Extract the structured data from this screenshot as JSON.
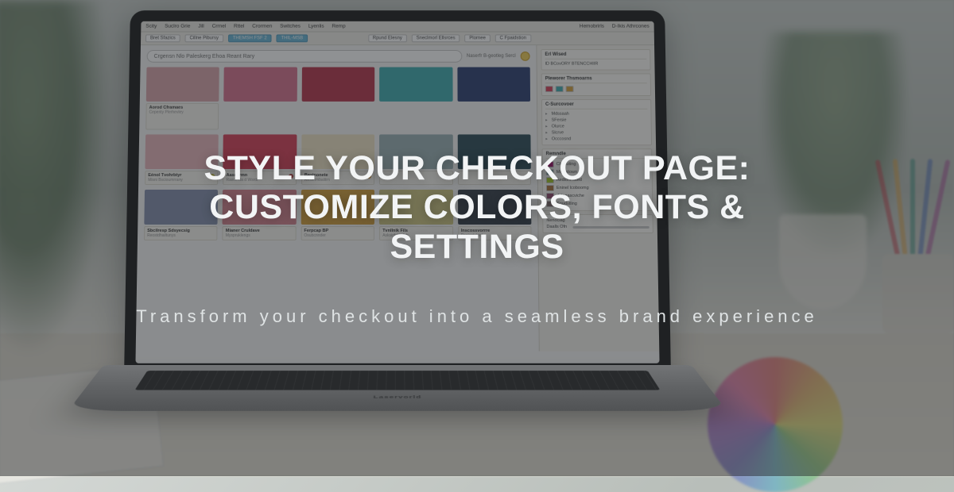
{
  "hero": {
    "title": "STYLE YOUR CHECKOUT PAGE: CUSTOMIZE COLORS, FONTS & SETTINGS",
    "subtitle": "Transform your checkout into a seamless brand experience"
  },
  "laptop": {
    "brand": "Laservorld"
  },
  "app": {
    "menubar": [
      "Scity",
      "Suclro Grie",
      "Jill",
      "Crrnel",
      "Rttel",
      "Crormen",
      "Switches",
      "Lyenlis",
      "Remp"
    ],
    "menubar_right": [
      "Hemobrirls",
      "D-Ikis Athrcones"
    ],
    "toolbar1": {
      "items": [
        "Bret Sfazics",
        "Cillne Pibursy"
      ],
      "accent": "THEMSH FSF 2",
      "accent2": "THIL-MSB"
    },
    "toolbar2": {
      "items": [
        "Rpund Elesny",
        "Sneclmorl Ellsrces",
        "Plornee",
        "C Fpaidstion"
      ]
    },
    "search": {
      "placeholder": "Crgensn Nlo Paleskerg  Ehoa Reant Rary",
      "side_label": "Naserfr B-geotleg Sercl"
    },
    "swatches": [
      {
        "color": "#dba9ae",
        "name": "Aorod Cframaes",
        "sub": "Ceperity Plerhevley"
      },
      {
        "color": "#d97a95",
        "name": "",
        "sub": ""
      },
      {
        "color": "#ba4055",
        "name": "",
        "sub": ""
      },
      {
        "color": "#4ab0b5",
        "name": "",
        "sub": ""
      },
      {
        "color": "#384a7a",
        "name": "",
        "sub": ""
      },
      {
        "color": "#e9b8be",
        "name": "Eénol Tvohrbtyr",
        "sub": "Misni Bscioumrrany",
        "dot": "#d0c850"
      },
      {
        "color": "#d84a60",
        "name": "Aasesrmn",
        "sub": "Rascerda d Wsrdl",
        "dot": "#b85050"
      },
      {
        "color": "#f0e5c8",
        "name": "Basinonete",
        "sub": "Resteimbalitrn",
        "dot": "#c48a3a"
      },
      {
        "color": "#a0b5b8",
        "name": "",
        "sub": ""
      },
      {
        "color": "#385560",
        "name": "",
        "sub": ""
      },
      {
        "color": "#8a95b0",
        "name": "Sbcilresp Sdsyecsig",
        "sub": "Reostdhailtunys"
      },
      {
        "color": "#d88a95",
        "name": "Mianer Cruldave",
        "sub": "Myspruklengs"
      },
      {
        "color": "#d6a548",
        "name": "Ferpcap BP",
        "sub": "Osubcnnder"
      },
      {
        "color": "#d0c888",
        "name": "Tvnllnik Fils",
        "sub": "Asksightthnfch"
      },
      {
        "color": "#404852",
        "name": "Inscossvorrre",
        "sub": "Panisctehtol"
      }
    ],
    "panel": {
      "section1_title": "Erl Wised",
      "section1_item": "ID BCovORY BTENCCHIIR",
      "section2_title": "Pleworer Thsmoarns",
      "section3_title": "C-Surcovoer",
      "collapsible": [
        "Mdssaah",
        "SFersie",
        "Olurce",
        "Slcrve",
        "Occcosnd"
      ],
      "section4_title": "Remndle",
      "items": [
        "Cbsnuting",
        "Mipastown",
        "Aediorlinated",
        "Eninel lcoboomg",
        "dstagascviche",
        "Soudstling"
      ],
      "prop_label": "Nenociag",
      "slider_label": "Daalls Ofn"
    }
  }
}
